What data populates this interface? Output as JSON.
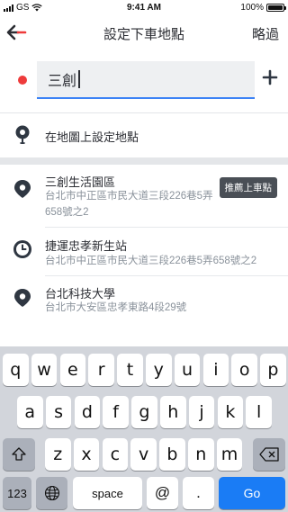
{
  "status_bar": {
    "carrier": "GS",
    "time": "9:41 AM",
    "battery_text": "100%",
    "battery_level": 1.0
  },
  "nav": {
    "back_icon": "back-arrow-icon",
    "title": "設定下車地點",
    "skip_label": "略過"
  },
  "search": {
    "value": "三創",
    "marker_color": "#ee3b3b",
    "add_icon": "plus-icon"
  },
  "map_option": {
    "icon": "pin-icon",
    "label": "在地圖上設定地點"
  },
  "results": [
    {
      "icon": "location-pin-icon",
      "title": "三創生活園區",
      "address_line1": "台北市中正區市民大道三段226巷5弄",
      "address_line2": "658號之2",
      "badge": "推薦上車點"
    },
    {
      "icon": "clock-icon",
      "title": "捷運忠孝新生站",
      "address_line1": "台北市中正區市民大道三段226巷5弄658號之2"
    },
    {
      "icon": "location-pin-icon",
      "title": "台北科技大學",
      "address_line1": "台北市大安區忠孝東路4段29號"
    }
  ],
  "keyboard": {
    "row1": [
      "q",
      "w",
      "e",
      "r",
      "t",
      "y",
      "u",
      "i",
      "o",
      "p"
    ],
    "row2": [
      "a",
      "s",
      "d",
      "f",
      "g",
      "h",
      "j",
      "k",
      "l"
    ],
    "row3": [
      "z",
      "x",
      "c",
      "v",
      "b",
      "n",
      "m"
    ],
    "shift_icon": "shift-icon",
    "delete_icon": "backspace-icon",
    "numbers_label": "123",
    "globe_icon": "globe-icon",
    "space_label": "space",
    "at_label": "@",
    "dot_label": ".",
    "go_label": "Go"
  },
  "colors": {
    "accent_blue": "#1a7cf5",
    "badge_bg": "#4a4f56",
    "icon_dark": "#2f3742"
  }
}
